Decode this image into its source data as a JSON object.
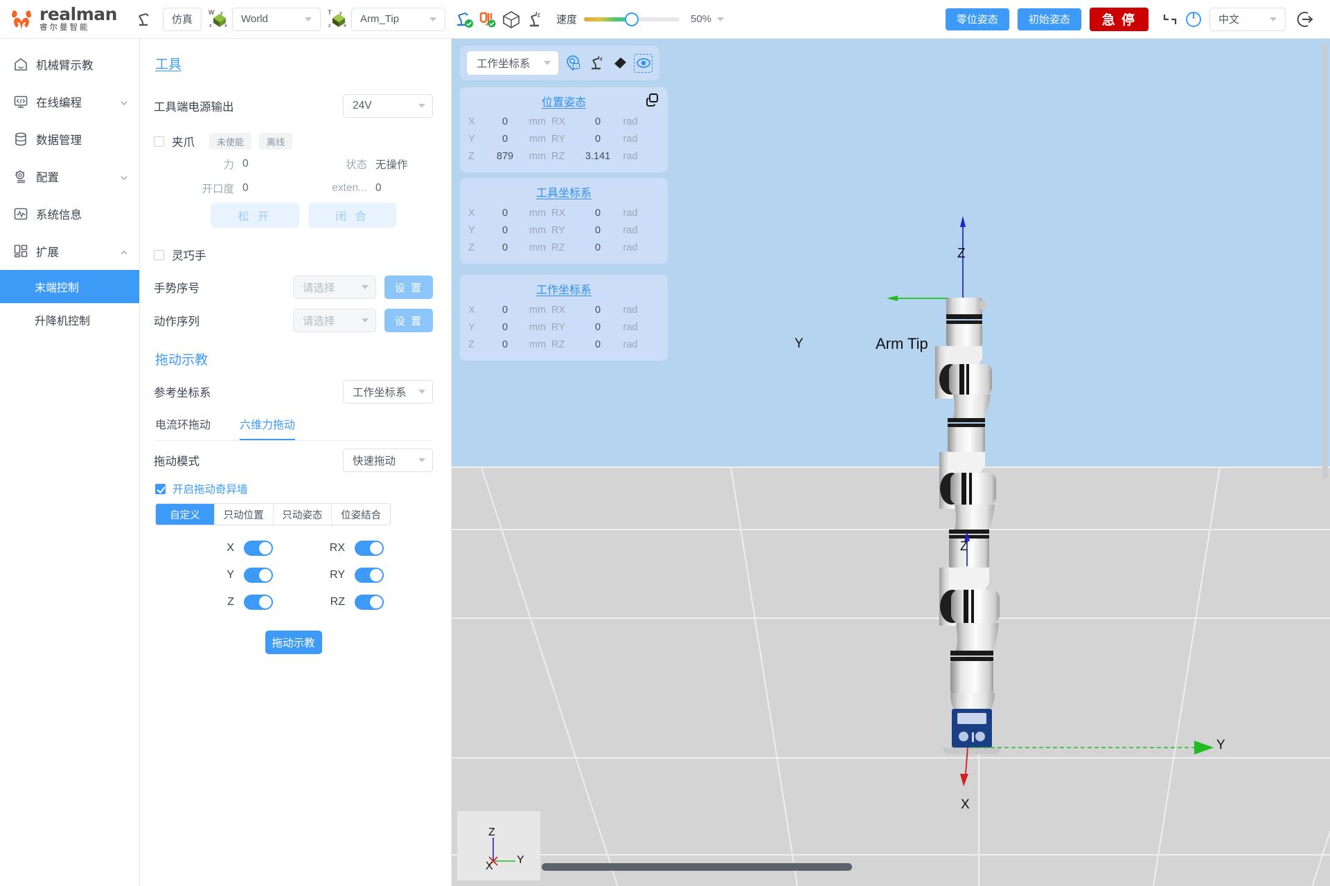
{
  "brand": {
    "name_en": "realman",
    "name_cn": "睿尔曼智能"
  },
  "topbar": {
    "robot_icon": "robot-arm-icon",
    "mode_button": "仿真",
    "world_frame_icon": "world-axis-icon",
    "world_frame": "World",
    "tool_frame_icon": "tool-axis-icon",
    "tool_frame": "Arm_Tip",
    "teach_icon": "robot-teach-status-icon",
    "cable_icon": "cable-status-icon",
    "cube_icon": "collision-cube-icon",
    "collide_icon": "robot-collision-icon",
    "speed_label": "速度",
    "speed_value": "50%",
    "zero_pose_button": "零位姿态",
    "init_pose_button": "初始姿态",
    "estop_button": "急 停",
    "corner_icon": "resize-corner-icon",
    "power_icon": "power-icon",
    "language": "中文",
    "logout_icon": "logout-icon"
  },
  "sidebar": {
    "items": [
      {
        "label": "机械臂示教",
        "icon": "home-icon",
        "arrow": "",
        "active": false
      },
      {
        "label": "在线编程",
        "icon": "code-monitor-icon",
        "arrow": "down",
        "active": false
      },
      {
        "label": "数据管理",
        "icon": "database-icon",
        "arrow": "",
        "active": false
      },
      {
        "label": "配置",
        "icon": "gear-icon",
        "arrow": "down",
        "active": false
      },
      {
        "label": "系统信息",
        "icon": "pulse-icon",
        "arrow": "",
        "active": false
      },
      {
        "label": "扩展",
        "icon": "grid-blocks-icon",
        "arrow": "up",
        "active": false
      }
    ],
    "sub_items": [
      {
        "label": "末端控制",
        "active": true
      },
      {
        "label": "升降机控制",
        "active": false
      }
    ]
  },
  "panel": {
    "tool_section_title": "工具",
    "power_output_label": "工具端电源输出",
    "power_output_value": "24V",
    "gripper": {
      "label": "夹爪",
      "checked": false,
      "tag_enabled": "未使能",
      "tag_online": "离线",
      "force_label": "力",
      "force_value": "0",
      "state_label": "状态",
      "state_value": "无操作",
      "opening_label": "开口度",
      "opening_value": "0",
      "extend_label": "exten...",
      "extend_value": "0",
      "open_button": "松 开",
      "close_button": "闭 合"
    },
    "dex_hand": {
      "label": "灵巧手",
      "checked": false,
      "gesture_label": "手势序号",
      "gesture_placeholder": "请选择",
      "gesture_set_button": "设 置",
      "action_label": "动作序列",
      "action_placeholder": "请选择",
      "action_set_button": "设 置"
    },
    "drag_teach": {
      "title": "拖动示教",
      "ref_frame_label": "参考坐标系",
      "ref_frame_value": "工作坐标系",
      "tabs": [
        {
          "label": "电流环拖动",
          "active": false
        },
        {
          "label": "六维力拖动",
          "active": true
        }
      ],
      "mode_label": "拖动模式",
      "mode_value": "快速拖动",
      "singularity_checkbox_label": "开启拖动奇异墙",
      "singularity_checked": true,
      "segments": [
        {
          "label": "自定义",
          "active": true
        },
        {
          "label": "只动位置",
          "active": false
        },
        {
          "label": "只动姿态",
          "active": false
        },
        {
          "label": "位姿结合",
          "active": false
        }
      ],
      "toggles": [
        {
          "label": "X",
          "on": true
        },
        {
          "label": "RX",
          "on": true
        },
        {
          "label": "Y",
          "on": true
        },
        {
          "label": "RY",
          "on": true
        },
        {
          "label": "Z",
          "on": true
        },
        {
          "label": "RZ",
          "on": true
        }
      ],
      "action_button": "拖动示教"
    }
  },
  "viewport": {
    "frame_select": "工作坐标系",
    "tool_icons": [
      {
        "name": "locate-point-icon",
        "boxed": false
      },
      {
        "name": "robot-base-icon",
        "boxed": false
      },
      {
        "name": "eraser-icon",
        "boxed": false
      },
      {
        "name": "focus-eye-icon",
        "boxed": true
      }
    ],
    "cards": [
      {
        "title": "位置姿态",
        "copy_icon": "copy-icon",
        "rows": [
          {
            "axis": "X",
            "value": "0",
            "unit": "mm",
            "raxis": "RX",
            "rvalue": "0",
            "runit": "rad"
          },
          {
            "axis": "Y",
            "value": "0",
            "unit": "mm",
            "raxis": "RY",
            "rvalue": "0",
            "runit": "rad"
          },
          {
            "axis": "Z",
            "value": "879",
            "unit": "mm",
            "raxis": "RZ",
            "rvalue": "3.141",
            "runit": "rad"
          }
        ]
      },
      {
        "title": "工具坐标系",
        "copy_icon": "",
        "rows": [
          {
            "axis": "X",
            "value": "0",
            "unit": "mm",
            "raxis": "RX",
            "rvalue": "0",
            "runit": "rad"
          },
          {
            "axis": "Y",
            "value": "0",
            "unit": "mm",
            "raxis": "RY",
            "rvalue": "0",
            "runit": "rad"
          },
          {
            "axis": "Z",
            "value": "0",
            "unit": "mm",
            "raxis": "RZ",
            "rvalue": "0",
            "runit": "rad"
          }
        ]
      },
      {
        "title": "工作坐标系",
        "copy_icon": "",
        "rows": [
          {
            "axis": "X",
            "value": "0",
            "unit": "mm",
            "raxis": "RX",
            "rvalue": "0",
            "runit": "rad"
          },
          {
            "axis": "Y",
            "value": "0",
            "unit": "mm",
            "raxis": "RY",
            "rvalue": "0",
            "runit": "rad"
          },
          {
            "axis": "Z",
            "value": "0",
            "unit": "mm",
            "raxis": "RZ",
            "rvalue": "0",
            "runit": "rad"
          }
        ]
      }
    ],
    "scene": {
      "tip_label": "Arm Tip",
      "tip_axis_z": "Z",
      "tip_axis_y": "Y",
      "joint_axis_z": "Z",
      "base_axis_y": "Y",
      "base_axis_x": "X",
      "mini_axis_z": "Z",
      "mini_axis_y": "Y",
      "mini_axis_x": "X"
    }
  },
  "colors": {
    "accent": "#3d9bf7",
    "danger": "#cc0000",
    "brand_orange": "#f26522",
    "sky": "#b5d4f0",
    "ground": "#d4d4d4",
    "card_bg": "#ccdef7"
  }
}
